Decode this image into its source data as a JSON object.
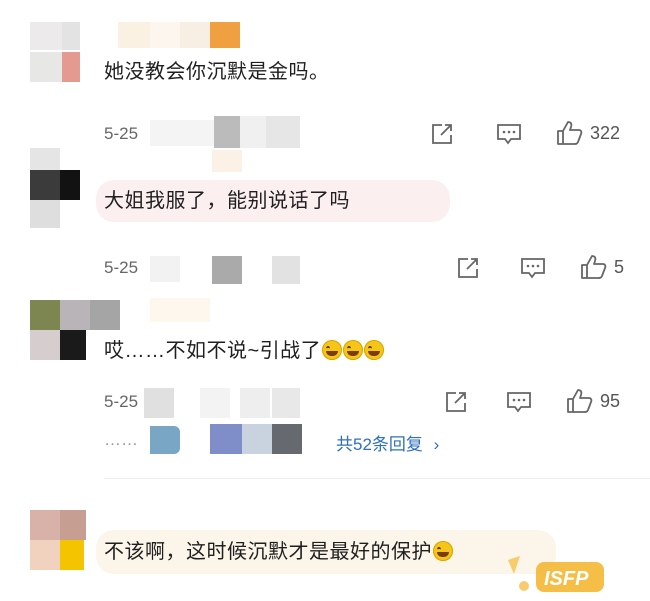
{
  "comments": [
    {
      "text": "她没教会你沉默是金吗。",
      "date": "5-25",
      "likes": "322"
    },
    {
      "text": "大姐我服了，能别说话了吗",
      "date": "5-25",
      "likes": "5"
    },
    {
      "text": "哎……不如不说~引战了",
      "date": "5-25",
      "likes": "95",
      "replies_dots": "……",
      "replies_link": "共52条回复",
      "replies_arrow": "›"
    },
    {
      "text": "不该啊，这时候沉默才是最好的保护"
    }
  ],
  "icons": {
    "share": "share-icon",
    "comment": "comment-icon",
    "like": "thumbs-up-icon",
    "laugh": "laughing-emoji-icon"
  },
  "watermark": "ISFP",
  "colors": {
    "bubble": "#fbeff0",
    "bubble_last": "#fbf5ea",
    "link": "#2f6fbf",
    "meta": "#666666"
  }
}
